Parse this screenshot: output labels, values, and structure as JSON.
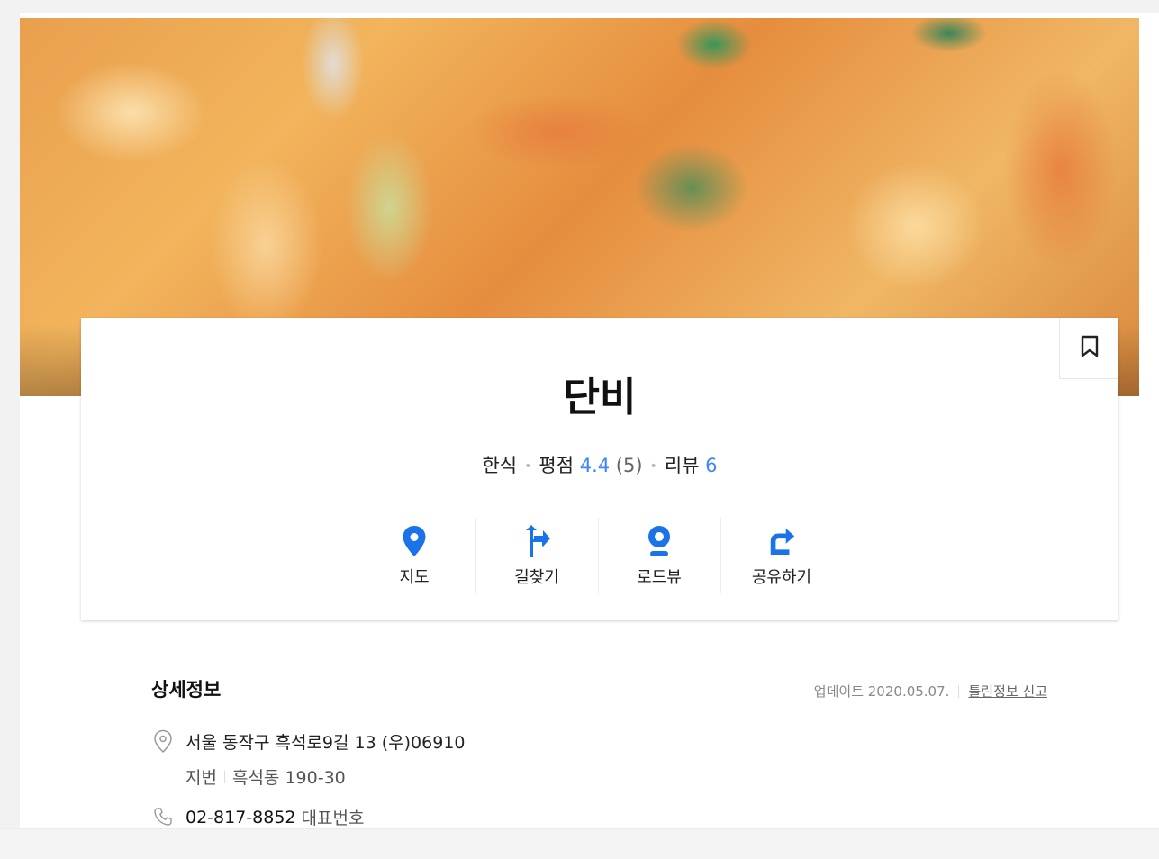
{
  "place": {
    "name": "단비",
    "category": "한식",
    "rating_label": "평점",
    "rating": "4.4",
    "rating_count": "(5)",
    "review_label": "리뷰",
    "review_count": "6"
  },
  "actions": [
    {
      "label": "지도",
      "icon": "map-pin-icon"
    },
    {
      "label": "길찾기",
      "icon": "directions-icon"
    },
    {
      "label": "로드뷰",
      "icon": "roadview-icon"
    },
    {
      "label": "공유하기",
      "icon": "share-icon"
    }
  ],
  "detail": {
    "heading": "상세정보",
    "updated": "업데이트 2020.05.07.",
    "report": "틀린정보 신고",
    "address": "서울 동작구 흑석로9길 13 (우)06910",
    "jibun_label": "지번",
    "jibun": "흑석동 190-30",
    "phone": "02-817-8852",
    "phone_tag": "대표번호"
  },
  "colors": {
    "accent": "#3d86ff"
  }
}
